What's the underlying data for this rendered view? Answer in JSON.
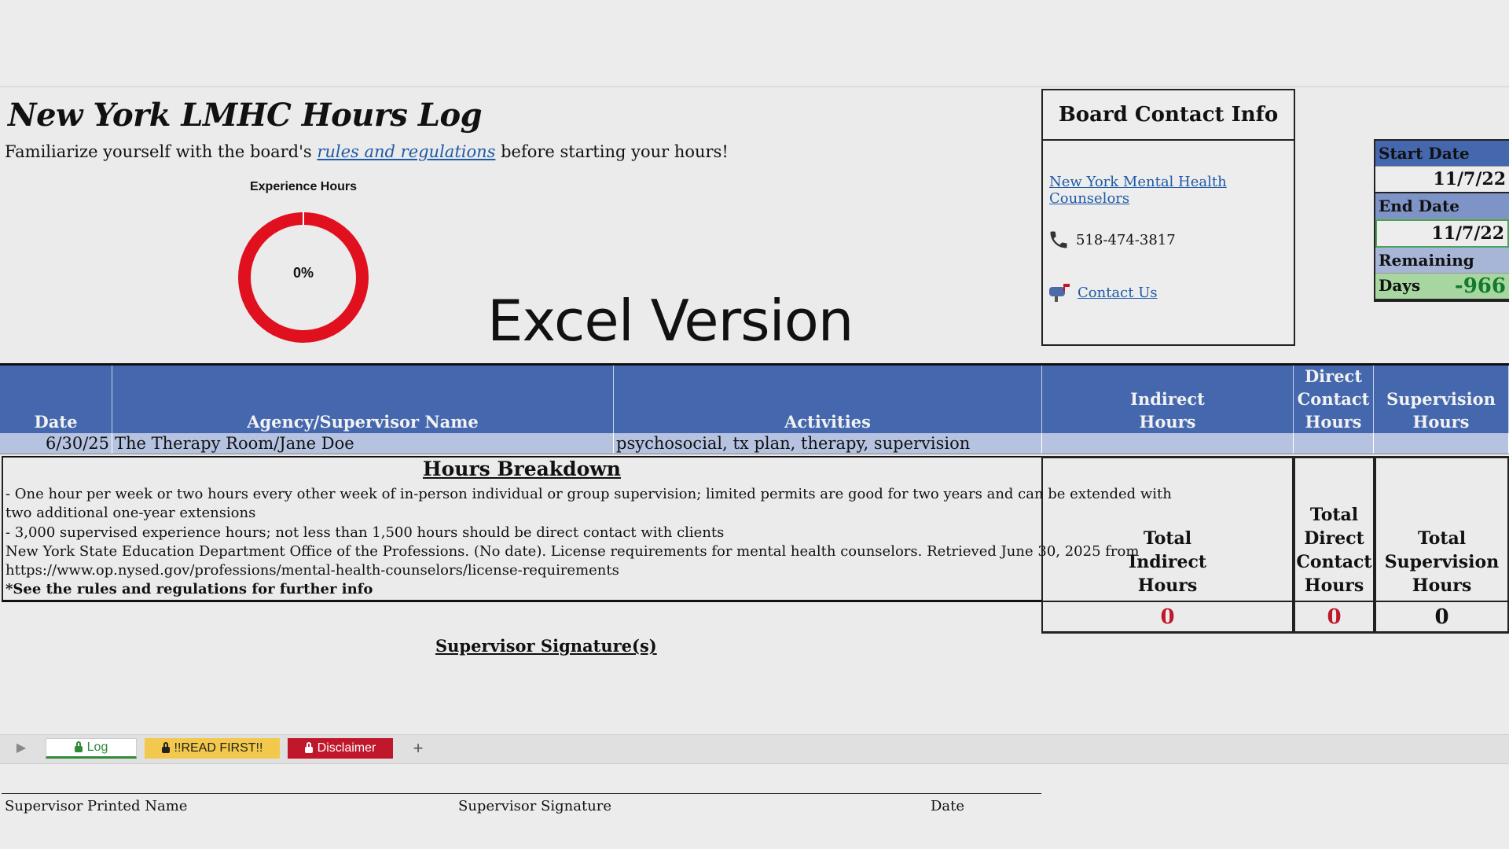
{
  "title": "New York LMHC Hours Log",
  "intro": {
    "before": "Familiarize yourself with the board's ",
    "link": "rules and regulations",
    "after": " before starting your hours!"
  },
  "gauge": {
    "title": "Experience Hours",
    "percent_label": "0%",
    "progress": 0,
    "color": "#e0101e"
  },
  "excel_version": "Excel Version",
  "contact": {
    "heading": "Board Contact Info",
    "link": "New York Mental Health Counselors",
    "phone": "518-474-3817",
    "contact_us": "Contact Us",
    "icons": [
      "phone-icon",
      "mailbox-icon"
    ]
  },
  "dates": {
    "start_label": "Start Date",
    "start_value": "11/7/22",
    "end_label": "End Date",
    "end_value": "11/7/22",
    "remaining_label": "Remaining Days",
    "remaining_value": "-966"
  },
  "table": {
    "headers": {
      "date": "Date",
      "agency": "Agency/Supervisor Name",
      "activities": "Activities",
      "indirect": "Indirect Hours",
      "direct": "Direct Contact Hours",
      "supervision": "Supervision Hours"
    },
    "rows": [
      {
        "date": "6/30/25",
        "agency": "The Therapy Room/Jane Doe",
        "activities": "psychosocial, tx plan, therapy, supervision",
        "indirect": "",
        "direct": "",
        "supervision": ""
      }
    ]
  },
  "breakdown": {
    "title": "Hours Breakdown",
    "lines": [
      "- One hour per week or two hours every other week of in-person individual or group supervision; limited permits are good for two years and can be extended with",
      "two additional one-year extensions",
      "- 3,000 supervised experience hours; not less than 1,500 hours should be direct contact with clients",
      "New York State Education Department Office of the Professions. (No date). License requirements for mental health counselors. Retrieved June 30, 2025 from",
      "https://www.op.nysed.gov/professions/mental-health-counselors/license-requirements"
    ],
    "note": "*See the rules and regulations for further info"
  },
  "totals": {
    "indirect_label": "Total Indirect Hours",
    "direct_label": "Total Direct Contact Hours",
    "supervision_label": "Total Supervision Hours",
    "indirect_value": "0",
    "direct_value": "0",
    "supervision_value": "0"
  },
  "signature": {
    "title": "Supervisor Signature(s)",
    "printed_name": "Supervisor Printed Name",
    "signature": "Supervisor Signature",
    "date": "Date"
  },
  "tabs": [
    {
      "label": "Log",
      "color": "#2f8a3a"
    },
    {
      "label": "!!READ FIRST!!",
      "color": "#f2c94c"
    },
    {
      "label": "Disclaimer",
      "color": "#c0172b"
    }
  ],
  "colors": {
    "header_blue": "#4467ad",
    "row_blue": "#b5c3e1",
    "red_value": "#c0172b",
    "green": "#117a2d"
  }
}
